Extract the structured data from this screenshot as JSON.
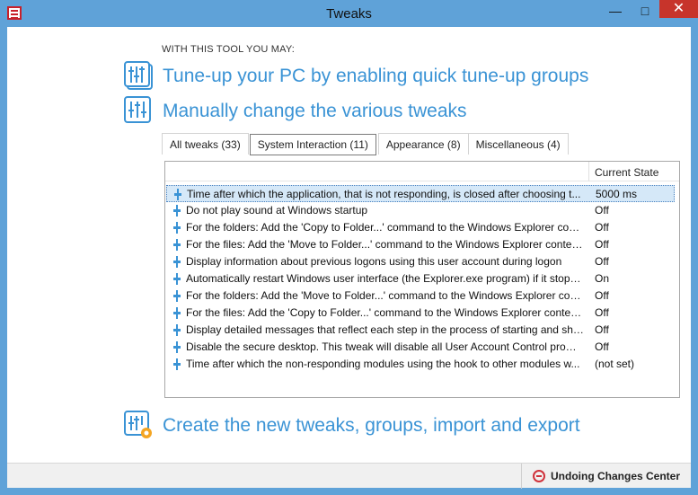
{
  "window": {
    "title": "Tweaks",
    "minimize_glyph": "—",
    "maximize_glyph": "□",
    "close_glyph": "✕"
  },
  "intro": {
    "heading": "WITH THIS TOOL YOU MAY:"
  },
  "actions": [
    {
      "label": "Tune-up your PC by enabling quick tune-up groups",
      "icon": "tuneup-groups-icon"
    },
    {
      "label": "Manually change the various tweaks",
      "icon": "sliders-icon"
    },
    {
      "label": "Create the new tweaks, groups, import and export",
      "icon": "sliders-gear-icon"
    }
  ],
  "tabs": [
    {
      "label": "All tweaks (33)",
      "active": false
    },
    {
      "label": "System Interaction (11)",
      "active": true
    },
    {
      "label": "Appearance (8)",
      "active": false
    },
    {
      "label": "Miscellaneous (4)",
      "active": false
    }
  ],
  "table": {
    "columns": {
      "name": "",
      "state": "Current State"
    },
    "rows": [
      {
        "name": "Time after which the application, that is not responding, is closed after choosing t...",
        "state": "5000 ms",
        "selected": true
      },
      {
        "name": "Do not play sound at Windows startup",
        "state": "Off"
      },
      {
        "name": "For the folders: Add the 'Copy to Folder...' command to the Windows Explorer cont...",
        "state": "Off"
      },
      {
        "name": "For the files: Add the 'Move to Folder...' command to the Windows Explorer contex...",
        "state": "Off"
      },
      {
        "name": "Display information about previous logons using this user account during logon",
        "state": "Off"
      },
      {
        "name": "Automatically restart Windows user interface (the Explorer.exe program) if it stops ...",
        "state": "On"
      },
      {
        "name": "For the folders: Add the 'Move to Folder...' command to the Windows Explorer con...",
        "state": "Off"
      },
      {
        "name": "For the files: Add the 'Copy to Folder...' command to the Windows Explorer context...",
        "state": "Off"
      },
      {
        "name": "Display detailed messages that reflect each step in the process of starting and shutt...",
        "state": "Off"
      },
      {
        "name": "Disable the secure desktop. This tweak will disable all User Account Control promp...",
        "state": "Off"
      },
      {
        "name": "Time after which the non-responding modules using the hook to other modules w...",
        "state": "(not set)"
      }
    ]
  },
  "statusbar": {
    "undo_label": "Undoing Changes Center"
  },
  "colors": {
    "accent": "#3a93d5",
    "frame": "#5fa2d8",
    "close": "#c7342b",
    "undo_icon": "#d0323b"
  }
}
